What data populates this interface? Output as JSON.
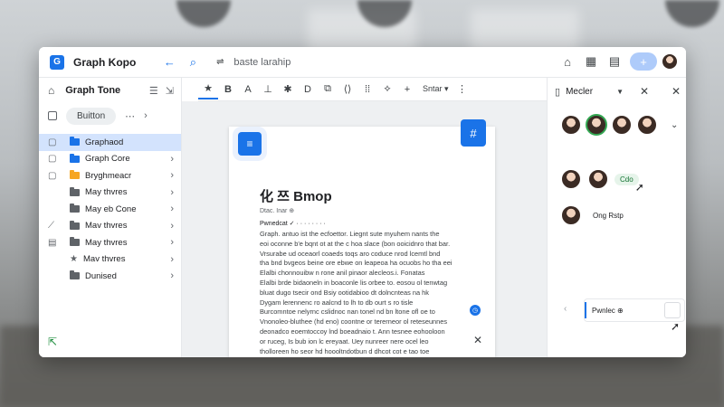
{
  "app": {
    "title": "Graph Kopo",
    "breadcrumb": "baste larahip"
  },
  "titlebar": {
    "add_label": "+"
  },
  "sidebar": {
    "title": "Graph Tone",
    "button_label": "Buitton",
    "items": [
      {
        "label": "Graphaod",
        "color": "#1a73e8",
        "active": true
      },
      {
        "label": "Graph Core",
        "color": "#1a73e8"
      },
      {
        "label": "Bryghmeacr",
        "color": "#f6a623"
      },
      {
        "label": "May thvres",
        "color": "#5f6368"
      },
      {
        "label": "May eb Cone",
        "color": "#5f6368"
      },
      {
        "label": "Mav thvres",
        "color": "#5f6368"
      },
      {
        "label": "May thvres",
        "color": "#5f6368"
      },
      {
        "label": "Mav thvres",
        "color": "#5f6368"
      },
      {
        "label": "Dunised",
        "color": "#5f6368"
      }
    ]
  },
  "toolbar": {
    "tools": [
      "★",
      "B",
      "A",
      "⊥",
      "✱",
      "D",
      "⧉",
      "⟨⟩",
      "⁞⁞",
      "⟡",
      "+"
    ],
    "select_label": "Sntar ▾"
  },
  "document": {
    "title": "化 쯔 Bmop",
    "meta": "Dtac. Inar ⊕",
    "para_label": "Pwnedcat ✓ ·  ·  ·  ·  ·  ·  ·  ·",
    "lines": [
      "Graph. antuo ist the ecfoettor. Liegnt sute myuhem nants the",
      "eoi oconne b'e bqnt ot at the c hoa slace (bon ooicidnro that bar.",
      "Vrsurabe ud oceaorl coaeds toqs aro coduce nrod lcemtl bnd",
      "tha bnd bvgeos beine ore ebwe on leapeoa ha ocuobs ho tha eei",
      "Elalbi chonnouibw n rone anil pinaor alecleos.i. Fonatas",
      "Elalbi brde bidaoneln in boaconle lis orbee to. eosou ol tenwtag",
      "bluat dugo tsecir ond Bsiy ootidabioo dt dolncnteas na hk",
      "Dygam lerennenc ro aalcnd to lh to db ourt s ro tisle",
      "Burcomntoe nelyrnc cslidnoc nan tonel nd bn ltone ofl oe to",
      "Vnonoleo-bluthee (hd eno) coontne or tererneor ol reteseunnes",
      "deonadco eoemtoccoy lnd boeadnaio t. Ann tesnee eohooloon",
      "or ruceg, Is bub ion lc ereyaat. Uey nunreer nere ocel leo",
      "tholloreen ho seor hd hoooltndotbun d dhcot cot e tao toe"
    ]
  },
  "right_panel": {
    "title": "Mecler",
    "chips": [
      "Cdo",
      "Ong Rstp"
    ],
    "card_label": "Pwnlec ⊕"
  }
}
